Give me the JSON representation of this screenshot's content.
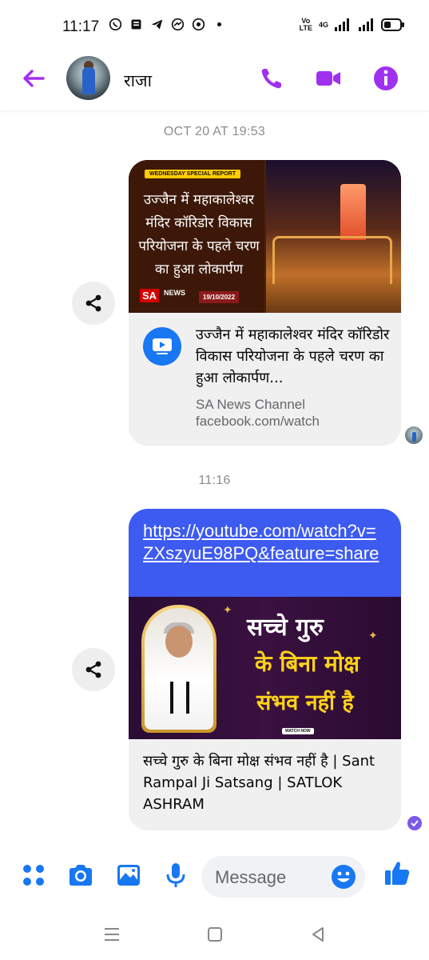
{
  "status_bar": {
    "time": "11:17",
    "network_label_top": "Vo",
    "network_label_bottom": "LTE",
    "network_gen": "4G"
  },
  "header": {
    "contact_name": "राजा",
    "accent_color": "#a030f0"
  },
  "chat": {
    "timestamp_1": "OCT 20 AT 19:53",
    "card1": {
      "thumb_tag": "WEDNESDAY SPECIAL REPORT",
      "thumb_headline": "उज्जैन में महाकालेश्वर मंदिर कॉरिडोर विकास परियोजना के पहले चरण का हुआ लोकार्पण",
      "thumb_logo": "SA",
      "thumb_logo_sub": "NEWS",
      "thumb_date": "19/10/2022",
      "title": "उज्जैन में महाकालेश्वर मंदिर कॉरिडोर विकास परियोजना के पहले चरण का हुआ लोकार्पण...",
      "source": "SA News Channel",
      "domain": "facebook.com/watch"
    },
    "timestamp_2": "11:16",
    "card2": {
      "url": "https://youtube.com/watch?v=ZXszyuE98PQ&feature=share",
      "thumb_line1": "सच्चे गुरु",
      "thumb_line2": "के बिना मोक्ष",
      "thumb_line3": "संभव नहीं है",
      "thumb_watch": "WATCH NOW",
      "title": "सच्चे गुरु के बिना मोक्ष संभव नहीं है | Sant Rampal Ji Satsang | SATLOK ASHRAM"
    }
  },
  "composer": {
    "placeholder": "Message"
  },
  "colors": {
    "messenger_blue": "#1877f2",
    "link_bubble": "#3d5af1",
    "bubble_gray": "#f0f0f0",
    "timestamp_gray": "#8a8d91"
  }
}
